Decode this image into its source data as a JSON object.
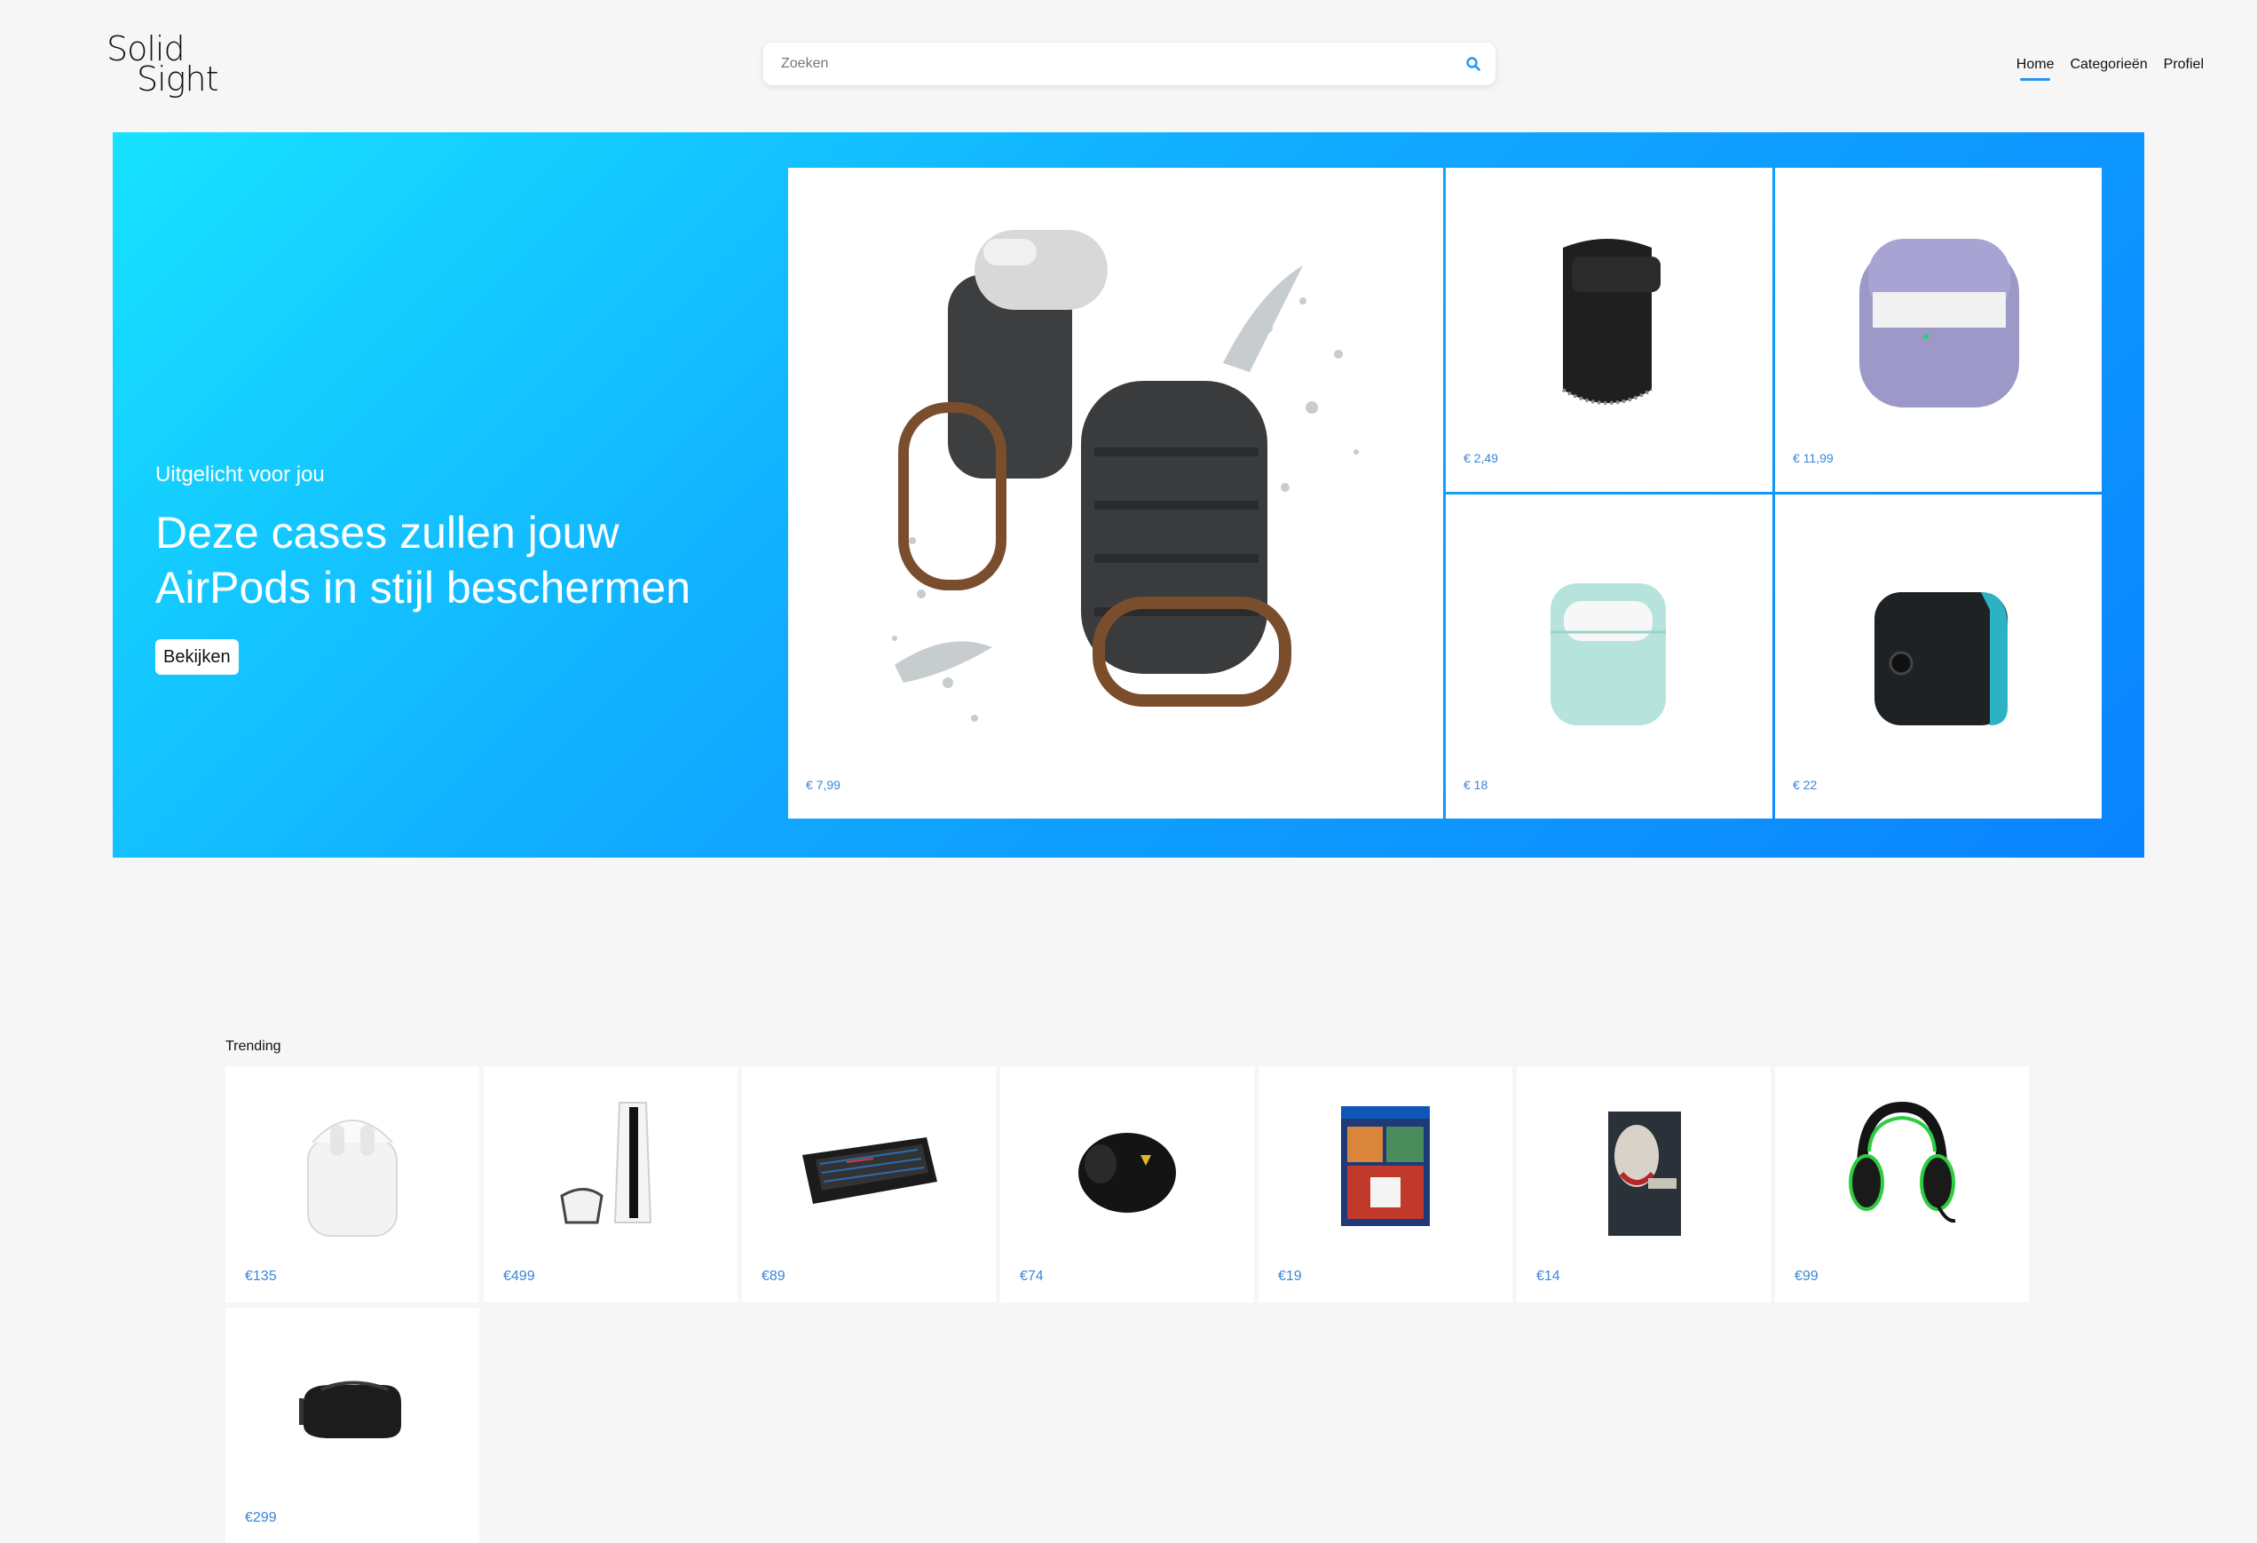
{
  "header": {
    "logo_line1": "Solid",
    "logo_line2": "Sight",
    "search_placeholder": "Zoeken",
    "nav": [
      {
        "label": "Home",
        "active": true
      },
      {
        "label": "Categorieën",
        "active": false
      },
      {
        "label": "Profiel",
        "active": false
      }
    ]
  },
  "hero": {
    "subtitle": "Uitgelicht voor jou",
    "title": "Deze cases zullen jouw AirPods in stijl beschermen",
    "button_label": "Bekijken",
    "gradient_colors": [
      "#17e2ff",
      "#0a84ff"
    ],
    "products": [
      {
        "icon": "waterproof-airpods-case-image",
        "price": "€ 7,99"
      },
      {
        "icon": "leather-airpods-pouch-image",
        "price": "€ 2,49"
      },
      {
        "icon": "lavender-airpods-pro-case-image",
        "price": "€ 11,99"
      },
      {
        "icon": "mint-airpods-case-image",
        "price": "€ 18"
      },
      {
        "icon": "black-teal-airpods-case-image",
        "price": "€ 22"
      }
    ]
  },
  "trending": {
    "title": "Trending",
    "items": [
      {
        "icon": "airpods-image",
        "price": "€135"
      },
      {
        "icon": "playstation-5-image",
        "price": "€499"
      },
      {
        "icon": "rgb-keyboard-image",
        "price": "€89"
      },
      {
        "icon": "gaming-mouse-image",
        "price": "€74"
      },
      {
        "icon": "gta-v-ps4-game-image",
        "price": "€19"
      },
      {
        "icon": "joker-bluray-image",
        "price": "€14"
      },
      {
        "icon": "green-headset-image",
        "price": "€99"
      },
      {
        "icon": "vr-headset-image",
        "price": "€299"
      }
    ]
  },
  "colors": {
    "accent": "#2196f3",
    "price": "#3a86d6",
    "background": "#f6f6f6"
  }
}
